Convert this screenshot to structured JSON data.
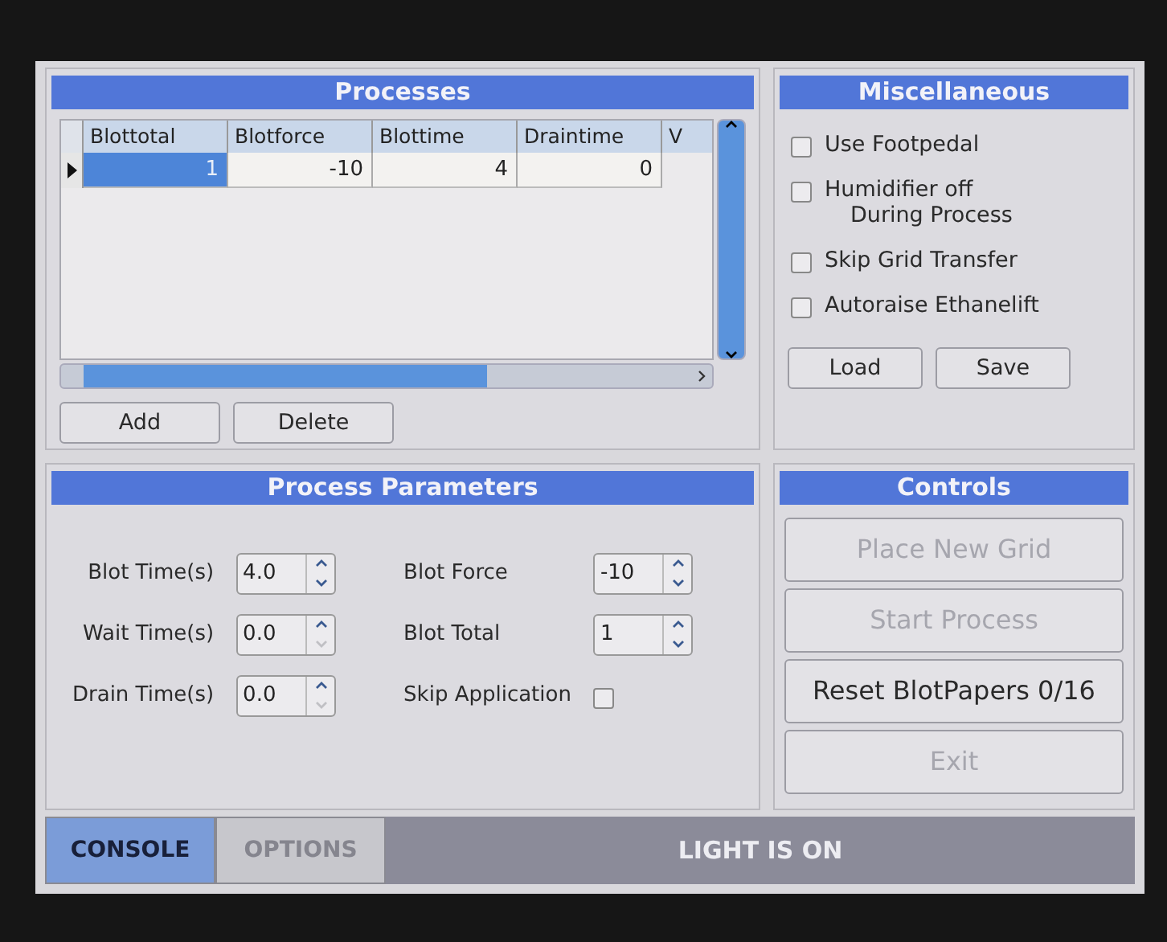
{
  "processes": {
    "title": "Processes",
    "columns": [
      "Blottotal",
      "Blotforce",
      "Blottime",
      "Draintime",
      "V"
    ],
    "rows": [
      {
        "selected": true,
        "cells": [
          {
            "text": "1",
            "selected": true
          },
          {
            "text": "-10",
            "selected": false
          },
          {
            "text": "4",
            "selected": false
          },
          {
            "text": "0",
            "selected": false
          }
        ]
      }
    ],
    "buttons": [
      "Add",
      "Delete"
    ]
  },
  "miscellaneous": {
    "title": "Miscellaneous",
    "options": [
      {
        "label": "Use Footpedal",
        "checked": false
      },
      {
        "label": "Humidifier off",
        "sublabel": "During Process",
        "checked": false
      },
      {
        "label": "Skip Grid Transfer",
        "checked": false
      },
      {
        "label": "Autoraise Ethanelift",
        "checked": false
      }
    ],
    "buttons": [
      "Load",
      "Save"
    ]
  },
  "process_parameters": {
    "title": "Process Parameters",
    "left": [
      {
        "label": "Blot Time(s)",
        "value": "4.0",
        "down_disabled": false
      },
      {
        "label": "Wait Time(s)",
        "value": "0.0",
        "down_disabled": true
      },
      {
        "label": "Drain Time(s)",
        "value": "0.0",
        "down_disabled": true
      }
    ],
    "right": [
      {
        "kind": "spin",
        "label": "Blot Force",
        "value": "-10",
        "down_disabled": false
      },
      {
        "kind": "spin",
        "label": "Blot Total",
        "value": "1",
        "down_disabled": false
      },
      {
        "kind": "check",
        "label": "Skip Application",
        "checked": false
      }
    ]
  },
  "controls": {
    "title": "Controls",
    "buttons": [
      {
        "label": "Place New Grid",
        "disabled": true
      },
      {
        "label": "Start Process",
        "disabled": true
      },
      {
        "label": "Reset BlotPapers 0/16",
        "disabled": false
      },
      {
        "label": "Exit",
        "disabled": true
      }
    ]
  },
  "tabs": [
    {
      "label": "CONSOLE",
      "selected": true
    },
    {
      "label": "OPTIONS",
      "selected": false
    }
  ],
  "status": "LIGHT IS ON"
}
